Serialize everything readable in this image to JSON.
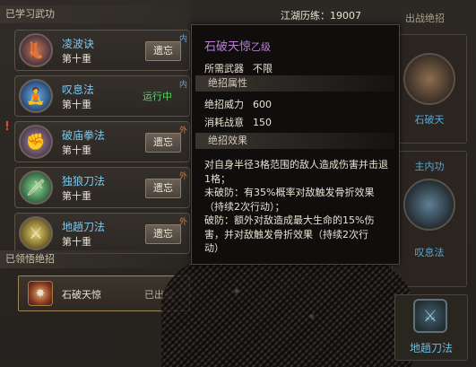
{
  "left": {
    "learned_header": "已学习武功",
    "skills": [
      {
        "name": "凌波诀",
        "level": "第十重",
        "action": "遗忘",
        "tag": "内",
        "icon": "boot-icon"
      },
      {
        "name": "叹息法",
        "level": "第十重",
        "status": "运行中",
        "tag": "内",
        "icon": "meditation-icon"
      },
      {
        "name": "破庙拳法",
        "level": "第十重",
        "action": "遗忘",
        "tag": "外",
        "icon": "fist-icon",
        "alert": "!"
      },
      {
        "name": "独狼刀法",
        "level": "第十重",
        "action": "遗忘",
        "tag": "外",
        "icon": "blade-icon"
      },
      {
        "name": "地趟刀法",
        "level": "第十重",
        "action": "遗忘",
        "tag": "外",
        "icon": "dagger-icon"
      }
    ],
    "ultimates_header": "已领悟绝招",
    "ultimate": {
      "name": "石破天惊",
      "state": "已出战"
    }
  },
  "right": {
    "xp_label": "江湖历练：",
    "xp_value": "19007",
    "title": "出战绝招",
    "slot1_label": "石破天",
    "slot2_label_a": "主内功",
    "slot2_label_b": "叹息法",
    "bottom_slot_label": "地趟刀法"
  },
  "tooltip": {
    "name": "石破天惊",
    "grade": "乙级",
    "weapon_label": "所需武器",
    "weapon_value": "不限",
    "attr_header": "绝招属性",
    "power_label": "绝招威力",
    "power_value": "600",
    "cost_label": "消耗战意",
    "cost_value": "150",
    "effect_header": "绝招效果",
    "desc": [
      "对自身半径3格范围的敌人造成伤害并击退",
      "1格；",
      "未破防：有35%概率对敌触发骨折效果",
      "（持续2次行动）；",
      "破防：额外对敌造成最大生命的15%伤",
      "害，并对敌触发骨折效果（持续2次行",
      "动）"
    ]
  }
}
